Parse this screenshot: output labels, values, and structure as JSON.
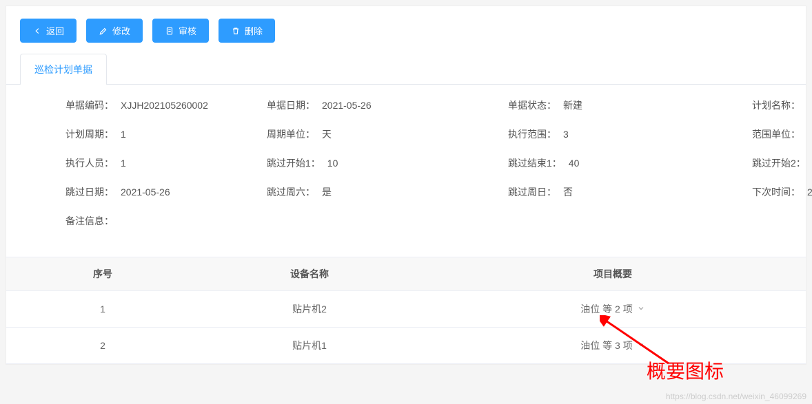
{
  "toolbar": {
    "back": "返回",
    "edit": "修改",
    "audit": "审核",
    "delete": "删除"
  },
  "tabs": {
    "main": "巡检计划单据"
  },
  "form": {
    "codeLabel": "单据编码：",
    "codeValue": "XJJH202105260002",
    "dateLabel": "单据日期：",
    "dateValue": "2021-05-26",
    "statusLabel": "单据状态：",
    "statusValue": "新建",
    "planNameLabel": "计划名称：",
    "planNameValue": "​",
    "cycleLabel": "计划周期：",
    "cycleValue": "1",
    "cycleUnitLabel": "周期单位：",
    "cycleUnitValue": "天",
    "rangeLabel": "执行范围：",
    "rangeValue": "3",
    "rangeUnitLabel": "范围单位：",
    "rangeUnitValue": "​",
    "staffLabel": "执行人员：",
    "staffValue": "1",
    "skipStart1Label": "跳过开始1：",
    "skipStart1Value": "10",
    "skipEnd1Label": "跳过结束1：",
    "skipEnd1Value": "40",
    "skipStart2Label": "跳过开始2：",
    "skipStart2Value": "",
    "skipDateLabel": "跳过日期：",
    "skipDateValue": "2021-05-26",
    "skipSatLabel": "跳过周六：",
    "skipSatValue": "是",
    "skipSunLabel": "跳过周日：",
    "skipSunValue": "否",
    "nextTimeLabel": "下次时间：",
    "nextTimeValue": "2",
    "remarkLabel": "备注信息："
  },
  "table": {
    "headers": {
      "seq": "序号",
      "device": "设备名称",
      "summary": "项目概要"
    },
    "rows": [
      {
        "seq": "1",
        "device": "贴片机2",
        "summary": "油位 等 2 项"
      },
      {
        "seq": "2",
        "device": "贴片机1",
        "summary": "油位 等 3 项"
      }
    ]
  },
  "annotation": {
    "text": "概要图标",
    "watermark": "https://blog.csdn.net/weixin_46099269"
  }
}
